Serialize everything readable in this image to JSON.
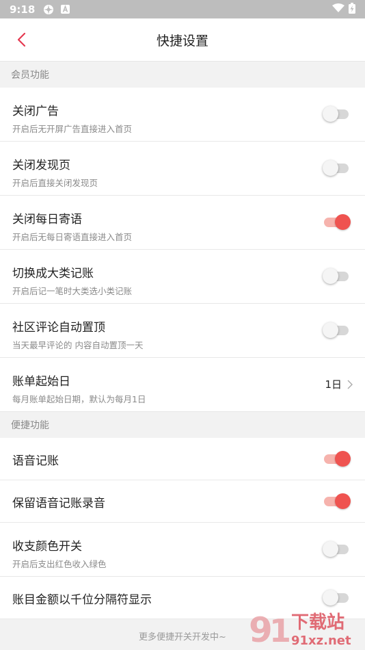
{
  "status_bar": {
    "time": "9:18",
    "icons": [
      "settings-gear-icon",
      "app-a-icon"
    ],
    "right_icons": [
      "wifi-icon",
      "battery-charging-icon"
    ]
  },
  "header": {
    "title": "快捷设置",
    "back_icon": "chevron-left-icon",
    "accent": "#e53950"
  },
  "sections": [
    {
      "title": "会员功能",
      "items": [
        {
          "label": "关闭广告",
          "sub": "开启后无开屏广告直接进入首页",
          "on": false
        },
        {
          "label": "关闭发现页",
          "sub": "开启后直接关闭发现页",
          "on": false
        },
        {
          "label": "关闭每日寄语",
          "sub": "开启后无每日寄语直接进入首页",
          "on": true
        },
        {
          "label": "切换成大类记账",
          "sub": "开启后记一笔时大类选小类记账",
          "on": false
        },
        {
          "label": "社区评论自动置顶",
          "sub": "当天最早评论的 内容自动置顶一天",
          "on": false
        },
        {
          "label": "账单起始日",
          "sub": "每月账单起始日期，默认为每月1日",
          "value": "1日"
        }
      ]
    },
    {
      "title": "便捷功能",
      "items": [
        {
          "label": "语音记账",
          "on": true
        },
        {
          "label": "保留语音记账录音",
          "on": true
        },
        {
          "label": "收支颜色开关",
          "sub": "开启后支出红色收入绿色",
          "on": false
        },
        {
          "label": "账目金额以千位分隔符显示",
          "on": false
        }
      ]
    }
  ],
  "footer": "更多便捷开关开发中~",
  "watermark": {
    "text": "下载站",
    "domain": "91xz.net"
  },
  "colors": {
    "toggle_on": "#ef5350",
    "toggle_on_track": "#f6b3ad",
    "toggle_off_track": "#d7d7d7"
  }
}
